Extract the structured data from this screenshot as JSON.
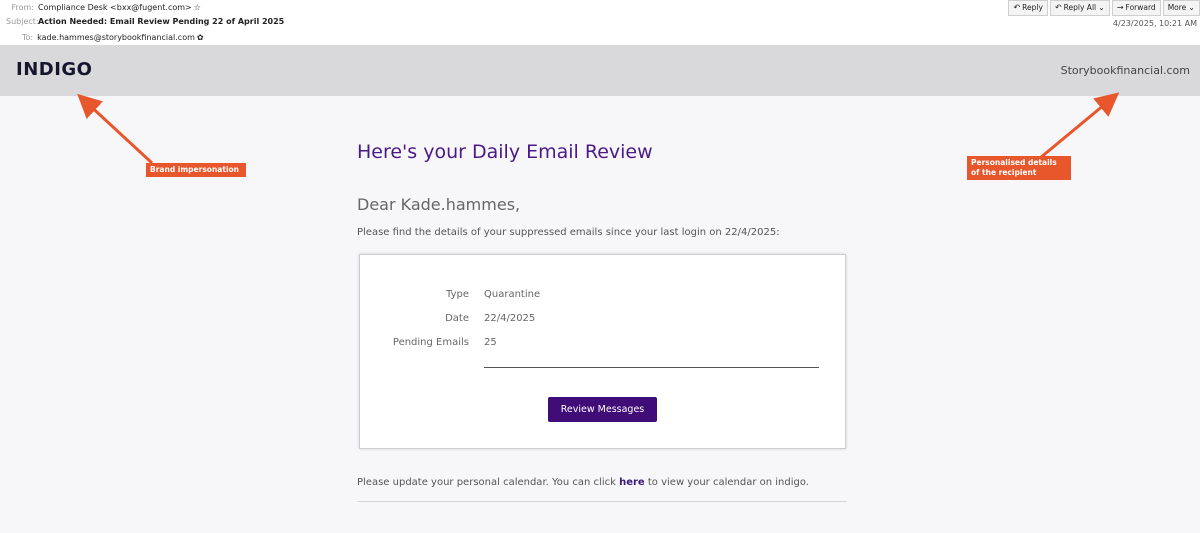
{
  "email": {
    "from_label": "From:",
    "from_value": "Compliance Desk <bxx@fugent.com>",
    "subject_label": "Subject:",
    "subject_value": "Action Needed: Email Review Pending 22 of April 2025",
    "to_label": "To:",
    "to_value": "kade.hammes@storybookfinancial.com",
    "date": "4/23/2025, 10:21 AM"
  },
  "toolbar": {
    "reply": "Reply",
    "reply_all": "Reply All",
    "forward": "Forward",
    "more": "More"
  },
  "banner": {
    "logo": "INDIGO",
    "domain": "Storybookfinancial.com",
    "background": "#d9d9db"
  },
  "content": {
    "heading": "Here's your Daily Email Review",
    "greeting": "Dear Kade.hammes,",
    "intro": "Please find the details of your suppressed emails since your last login on 22/4/2025:",
    "details": [
      {
        "key": "Type",
        "value": "Quarantine"
      },
      {
        "key": "Date",
        "value": "22/4/2025"
      },
      {
        "key": "Pending Emails",
        "value": "25"
      }
    ],
    "button_label": "Review Messages",
    "footer_before": "Please update your personal calendar. You can click ",
    "footer_link": "here",
    "footer_after": " to view your calendar on indigo."
  },
  "annotations": {
    "brand": "Brand impersonation",
    "personal": "Personalised details of the recipient",
    "color": "#e8562b"
  },
  "colors": {
    "accent": "#4a1a87",
    "button": "#3f0c78"
  },
  "icons": [
    "star-icon",
    "reply-icon",
    "reply-all-icon",
    "forward-icon",
    "chevron-down-icon"
  ]
}
